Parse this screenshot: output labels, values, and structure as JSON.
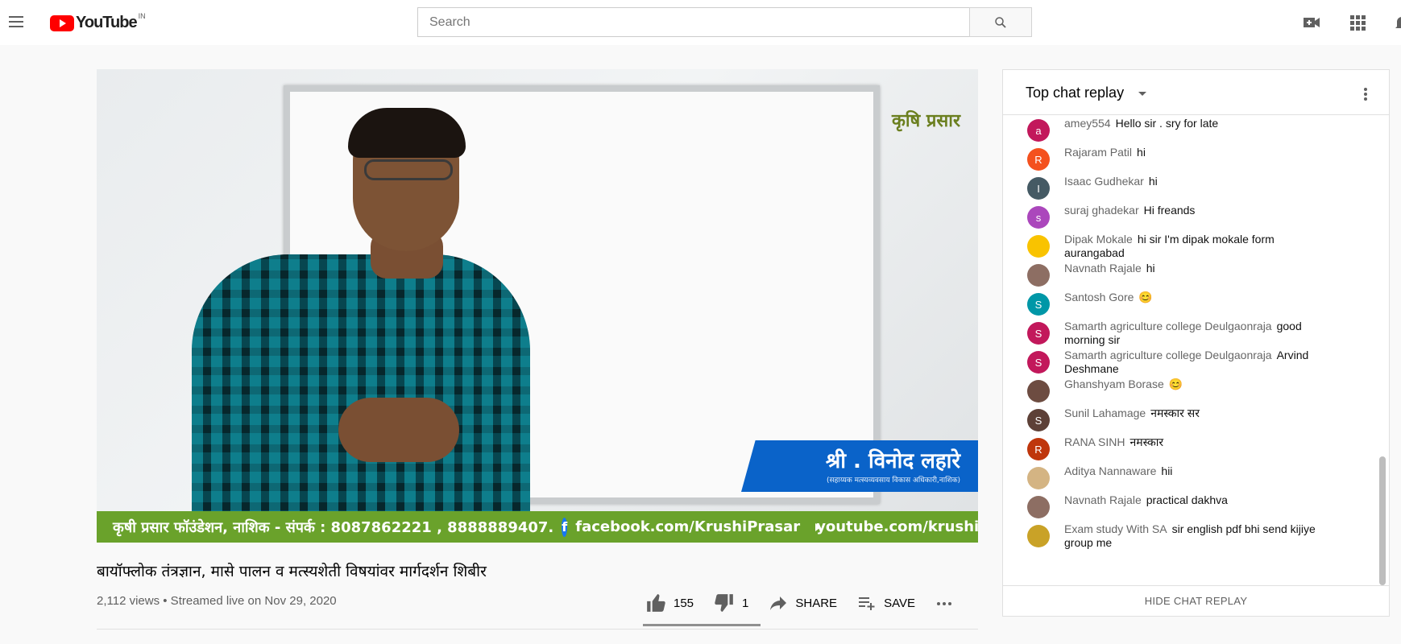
{
  "header": {
    "logo_text": "YouTube",
    "region": "IN",
    "search_placeholder": "Search"
  },
  "video": {
    "overlay_logo": "कृषि प्रसार",
    "name_plate": "श्री . विनोद लहारे",
    "name_subtitle": "(सहाय्यक मत्स्यव्यवसाय विकास अधिकारी,नाशिक)",
    "contact_strip": "कृषी प्रसार फॉउंडेशन, नाशिक - संपर्क : 8087862221 , 8888889407.",
    "facebook": "facebook.com/KrushiPrasar",
    "youtube": "youtube.com/krushiprasar",
    "title": "बायॉफ्लोक तंत्रज्ञान, मासे पालन व मत्स्यशेती विषयांवर मार्गदर्शन शिबीर",
    "meta": "2,112 views • Streamed live on Nov 29, 2020"
  },
  "actions": {
    "likes": "155",
    "dislikes": "1",
    "share": "SHARE",
    "save": "SAVE"
  },
  "chat": {
    "title": "Top chat replay",
    "hide_label": "HIDE CHAT REPLAY",
    "messages": [
      {
        "initial": "a",
        "color": "#c2185b",
        "author": "amey554",
        "text": "Hello sir . sry for late"
      },
      {
        "initial": "R",
        "color": "#f4511e",
        "author": "Rajaram Patil",
        "text": "hi"
      },
      {
        "initial": "I",
        "color": "#455a64",
        "author": "Isaac Gudhekar",
        "text": "hi"
      },
      {
        "initial": "s",
        "color": "#ab47bc",
        "author": "suraj ghadekar",
        "text": "Hi freands"
      },
      {
        "initial": "",
        "color": "#f9c300",
        "author": "Dipak Mokale",
        "text": "hi sir I'm dipak mokale form aurangabad"
      },
      {
        "initial": "",
        "color": "#8d6e63",
        "author": "Navnath Rajale",
        "text": "hi"
      },
      {
        "initial": "S",
        "color": "#0097a7",
        "author": "Santosh Gore",
        "text": "😊"
      },
      {
        "initial": "S",
        "color": "#c2185b",
        "author": "Samarth agriculture college Deulgaonraja",
        "text": "good morning sir"
      },
      {
        "initial": "S",
        "color": "#c2185b",
        "author": "Samarth agriculture college Deulgaonraja",
        "text": "Arvind Deshmane"
      },
      {
        "initial": "",
        "color": "#6d4c41",
        "author": "Ghanshyam Borase",
        "text": "😊"
      },
      {
        "initial": "S",
        "color": "#5d4037",
        "author": "Sunil Lahamage",
        "text": "नमस्कार सर"
      },
      {
        "initial": "R",
        "color": "#bf360c",
        "author": "RANA SINH",
        "text": "नमस्कार"
      },
      {
        "initial": "",
        "color": "#d4b483",
        "author": "Aditya Nannaware",
        "text": "hii"
      },
      {
        "initial": "",
        "color": "#8d6e63",
        "author": "Navnath Rajale",
        "text": "practical dakhva"
      },
      {
        "initial": "",
        "color": "#c9a227",
        "author": "Exam study With SA",
        "text": "sir english pdf bhi send kijiye group me"
      }
    ]
  }
}
